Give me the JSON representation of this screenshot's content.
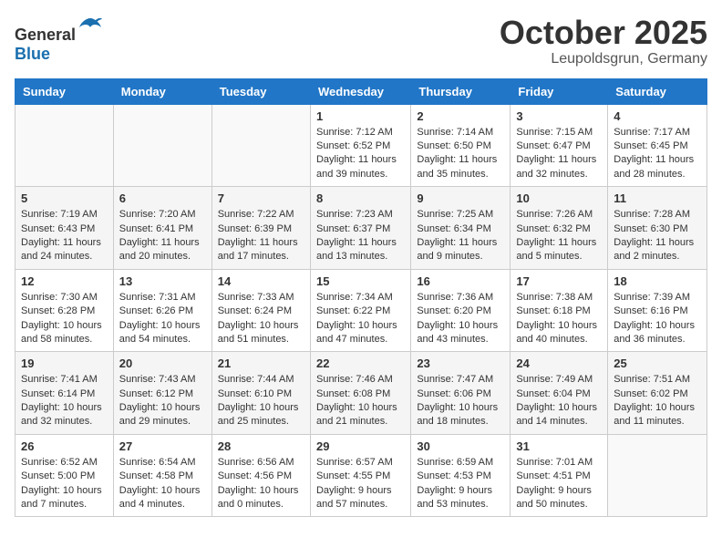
{
  "header": {
    "logo_general": "General",
    "logo_blue": "Blue",
    "month": "October 2025",
    "location": "Leupoldsgrun, Germany"
  },
  "weekdays": [
    "Sunday",
    "Monday",
    "Tuesday",
    "Wednesday",
    "Thursday",
    "Friday",
    "Saturday"
  ],
  "rows": [
    [
      {
        "day": "",
        "empty": true
      },
      {
        "day": "",
        "empty": true
      },
      {
        "day": "",
        "empty": true
      },
      {
        "day": "1",
        "sunrise": "7:12 AM",
        "sunset": "6:52 PM",
        "daylight": "11 hours and 39 minutes."
      },
      {
        "day": "2",
        "sunrise": "7:14 AM",
        "sunset": "6:50 PM",
        "daylight": "11 hours and 35 minutes."
      },
      {
        "day": "3",
        "sunrise": "7:15 AM",
        "sunset": "6:47 PM",
        "daylight": "11 hours and 32 minutes."
      },
      {
        "day": "4",
        "sunrise": "7:17 AM",
        "sunset": "6:45 PM",
        "daylight": "11 hours and 28 minutes."
      }
    ],
    [
      {
        "day": "5",
        "sunrise": "7:19 AM",
        "sunset": "6:43 PM",
        "daylight": "11 hours and 24 minutes."
      },
      {
        "day": "6",
        "sunrise": "7:20 AM",
        "sunset": "6:41 PM",
        "daylight": "11 hours and 20 minutes."
      },
      {
        "day": "7",
        "sunrise": "7:22 AM",
        "sunset": "6:39 PM",
        "daylight": "11 hours and 17 minutes."
      },
      {
        "day": "8",
        "sunrise": "7:23 AM",
        "sunset": "6:37 PM",
        "daylight": "11 hours and 13 minutes."
      },
      {
        "day": "9",
        "sunrise": "7:25 AM",
        "sunset": "6:34 PM",
        "daylight": "11 hours and 9 minutes."
      },
      {
        "day": "10",
        "sunrise": "7:26 AM",
        "sunset": "6:32 PM",
        "daylight": "11 hours and 5 minutes."
      },
      {
        "day": "11",
        "sunrise": "7:28 AM",
        "sunset": "6:30 PM",
        "daylight": "11 hours and 2 minutes."
      }
    ],
    [
      {
        "day": "12",
        "sunrise": "7:30 AM",
        "sunset": "6:28 PM",
        "daylight": "10 hours and 58 minutes."
      },
      {
        "day": "13",
        "sunrise": "7:31 AM",
        "sunset": "6:26 PM",
        "daylight": "10 hours and 54 minutes."
      },
      {
        "day": "14",
        "sunrise": "7:33 AM",
        "sunset": "6:24 PM",
        "daylight": "10 hours and 51 minutes."
      },
      {
        "day": "15",
        "sunrise": "7:34 AM",
        "sunset": "6:22 PM",
        "daylight": "10 hours and 47 minutes."
      },
      {
        "day": "16",
        "sunrise": "7:36 AM",
        "sunset": "6:20 PM",
        "daylight": "10 hours and 43 minutes."
      },
      {
        "day": "17",
        "sunrise": "7:38 AM",
        "sunset": "6:18 PM",
        "daylight": "10 hours and 40 minutes."
      },
      {
        "day": "18",
        "sunrise": "7:39 AM",
        "sunset": "6:16 PM",
        "daylight": "10 hours and 36 minutes."
      }
    ],
    [
      {
        "day": "19",
        "sunrise": "7:41 AM",
        "sunset": "6:14 PM",
        "daylight": "10 hours and 32 minutes."
      },
      {
        "day": "20",
        "sunrise": "7:43 AM",
        "sunset": "6:12 PM",
        "daylight": "10 hours and 29 minutes."
      },
      {
        "day": "21",
        "sunrise": "7:44 AM",
        "sunset": "6:10 PM",
        "daylight": "10 hours and 25 minutes."
      },
      {
        "day": "22",
        "sunrise": "7:46 AM",
        "sunset": "6:08 PM",
        "daylight": "10 hours and 21 minutes."
      },
      {
        "day": "23",
        "sunrise": "7:47 AM",
        "sunset": "6:06 PM",
        "daylight": "10 hours and 18 minutes."
      },
      {
        "day": "24",
        "sunrise": "7:49 AM",
        "sunset": "6:04 PM",
        "daylight": "10 hours and 14 minutes."
      },
      {
        "day": "25",
        "sunrise": "7:51 AM",
        "sunset": "6:02 PM",
        "daylight": "10 hours and 11 minutes."
      }
    ],
    [
      {
        "day": "26",
        "sunrise": "6:52 AM",
        "sunset": "5:00 PM",
        "daylight": "10 hours and 7 minutes."
      },
      {
        "day": "27",
        "sunrise": "6:54 AM",
        "sunset": "4:58 PM",
        "daylight": "10 hours and 4 minutes."
      },
      {
        "day": "28",
        "sunrise": "6:56 AM",
        "sunset": "4:56 PM",
        "daylight": "10 hours and 0 minutes."
      },
      {
        "day": "29",
        "sunrise": "6:57 AM",
        "sunset": "4:55 PM",
        "daylight": "9 hours and 57 minutes."
      },
      {
        "day": "30",
        "sunrise": "6:59 AM",
        "sunset": "4:53 PM",
        "daylight": "9 hours and 53 minutes."
      },
      {
        "day": "31",
        "sunrise": "7:01 AM",
        "sunset": "4:51 PM",
        "daylight": "9 hours and 50 minutes."
      },
      {
        "day": "",
        "empty": true
      }
    ]
  ],
  "labels": {
    "sunrise": "Sunrise:",
    "sunset": "Sunset:",
    "daylight": "Daylight:"
  }
}
